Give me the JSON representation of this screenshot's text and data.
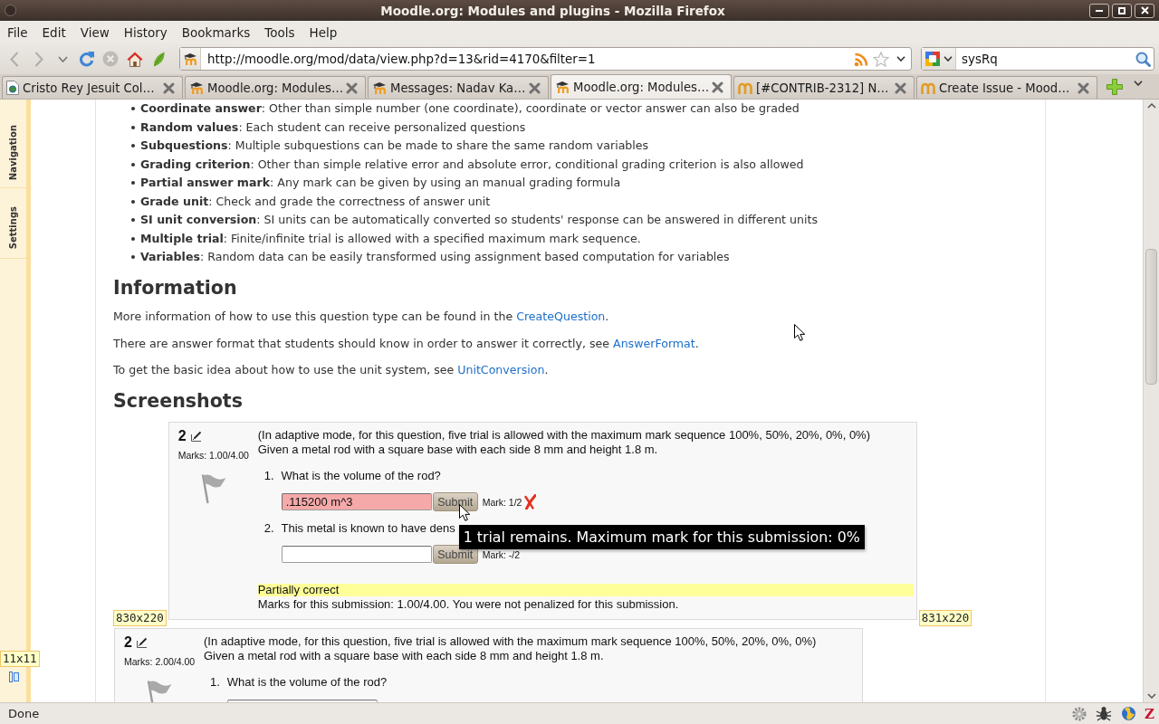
{
  "window": {
    "title": "Moodle.org: Modules and plugins - Mozilla Firefox"
  },
  "menu_bar": [
    "File",
    "Edit",
    "View",
    "History",
    "Bookmarks",
    "Tools",
    "Help"
  ],
  "navigation_toolbar": {
    "buttons": [
      {
        "kind": "back",
        "disabled": true
      },
      {
        "kind": "forward",
        "disabled": true
      },
      {
        "kind": "history",
        "disabled": false
      },
      {
        "kind": "reload",
        "disabled": false
      },
      {
        "kind": "stop",
        "disabled": true
      },
      {
        "kind": "home",
        "disabled": false
      },
      {
        "kind": "addon",
        "disabled": false
      }
    ],
    "url": "http://moodle.org/mod/data/view.php?d=13&rid=4170&filter=1",
    "search": {
      "value": "sysRq"
    }
  },
  "tabs": [
    {
      "label": "Cristo Rey Jesuit Col…",
      "selected": false,
      "kind": "page"
    },
    {
      "label": "Moodle.org: Modules…",
      "selected": false,
      "kind": "moodle"
    },
    {
      "label": "Messages: Nadav Ka…",
      "selected": false,
      "kind": "moodle"
    },
    {
      "label": "Moodle.org: Modules…",
      "selected": true,
      "kind": "moodle"
    },
    {
      "label": "[#CONTRIB-2312] N…",
      "selected": false,
      "kind": "tracker"
    },
    {
      "label": "Create Issue - Mood…",
      "selected": false,
      "kind": "tracker"
    }
  ],
  "sidebar_dock": {
    "tabs": [
      "Navigation",
      "Settings"
    ],
    "size_label": "11x11"
  },
  "article": {
    "features": [
      "**Coordinate answer**: Other than simple number (one coordinate), coordinate or vector answer can also be graded",
      "**Random values**: Each student can receive personalized questions",
      "**Subquestions**: Multiple subquestions can be made to share the same random variables",
      "**Grading criterion**: Other than simple relative error and absolute error, conditional grading criterion is also allowed",
      "**Partial answer mark**: Any mark can be given by using an manual grading formula",
      "**Grade unit**: Check and grade the correctness of answer unit",
      "**SI unit conversion**: SI units can be automatically converted so students' response can be answered in different units",
      "**Multiple trial**: Finite/infinite trial is allowed with a specified maximum mark sequence.",
      "**Variables**: Random data can be easily transformed using assignment based computation for variables"
    ],
    "information": {
      "heading": "Information",
      "paragraphs": [
        {
          "text": "More information of how to use this question type can be found in the ",
          "link": "CreateQuestion",
          "after": "."
        },
        {
          "text": "There are answer format that students should know in order to answer it correctly, see ",
          "link": "AnswerFormat",
          "after": "."
        },
        {
          "text": "To get the basic idea about how to use the unit system, see ",
          "link": "UnitConversion",
          "after": "."
        }
      ]
    },
    "screenshots": {
      "heading": "Screenshots",
      "size_labels": [
        "830x220",
        "831x220"
      ],
      "items": [
        {
          "number": "2",
          "marks": "Marks: 1.00/4.00",
          "intro": [
            "(In adaptive mode, for this question, five trial is allowed with the maximum mark sequence 100%, 50%, 20%, 0%, 0%)",
            "Given a metal rod with a square base with each side 8 mm and height 1.8 m."
          ],
          "parts": [
            {
              "number": "1.",
              "prompt": "What is the volume of the rod?",
              "answer": ".115200 m^3",
              "button": "Submit",
              "mark": "Mark: 1/2",
              "incorrect": true
            },
            {
              "number": "2.",
              "prompt": "This metal is known to have dens",
              "button": "Submit",
              "mark": "Mark: -/2",
              "incorrect": false
            }
          ],
          "tooltip": "1 trial remains. Maximum mark for this submission: 0%",
          "feedback": {
            "highlighted": true,
            "state": "Partially correct",
            "text": "Marks for this submission: 1.00/4.00. You were not penalized for this submission."
          }
        },
        {
          "number": "2",
          "marks": "Marks: 2.00/4.00",
          "intro": [
            "(In adaptive mode, for this question, five trial is allowed with the maximum mark sequence 100%, 50%, 20%, 0%, 0%)",
            "Given a metal rod with a square base with each side 8 mm and height 1.8 m."
          ],
          "parts": [
            {
              "number": "1.",
              "prompt": "What is the volume of the rod?",
              "incorrect": false
            }
          ]
        }
      ]
    }
  },
  "status_bar": {
    "text": "Done",
    "addon_logo": "Z"
  }
}
